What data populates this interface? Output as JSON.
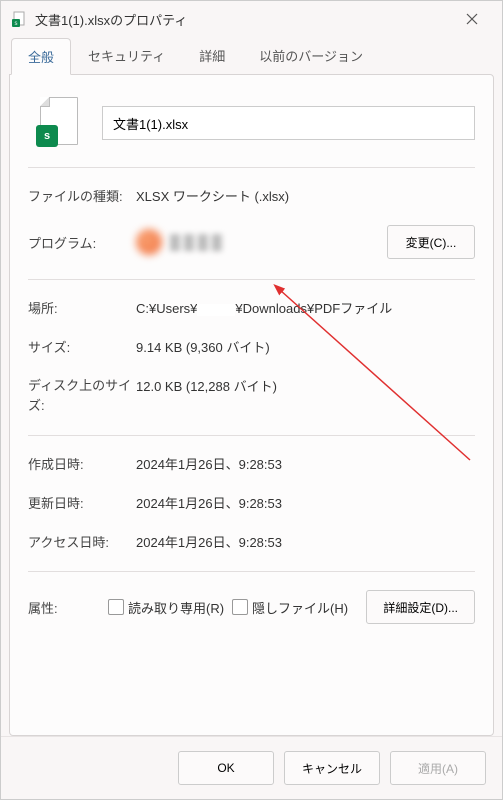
{
  "titlebar": {
    "text": "文書1(1).xlsxのプロパティ"
  },
  "tabs": {
    "general": "全般",
    "security": "セキュリティ",
    "details": "詳細",
    "previous": "以前のバージョン"
  },
  "file": {
    "name": "文書1(1).xlsx",
    "badge": "s"
  },
  "labels": {
    "filetype": "ファイルの種類:",
    "program": "プログラム:",
    "location": "場所:",
    "size": "サイズ:",
    "disksize": "ディスク上のサイズ:",
    "created": "作成日時:",
    "modified": "更新日時:",
    "accessed": "アクセス日時:",
    "attributes": "属性:"
  },
  "values": {
    "filetype": "XLSX ワークシート (.xlsx)",
    "location_pre": "C:¥Users¥",
    "location_post": "¥Downloads¥PDFファイル",
    "size": "9.14 KB (9,360 バイト)",
    "disksize": "12.0 KB (12,288 バイト)",
    "created": "2024年1月26日、9:28:53",
    "modified": "2024年1月26日、9:28:53",
    "accessed": "2024年1月26日、9:28:53"
  },
  "buttons": {
    "change": "変更(C)...",
    "advanced": "詳細設定(D)...",
    "ok": "OK",
    "cancel": "キャンセル",
    "apply": "適用(A)"
  },
  "checkboxes": {
    "readonly": "読み取り専用(R)",
    "hidden": "隠しファイル(H)"
  }
}
